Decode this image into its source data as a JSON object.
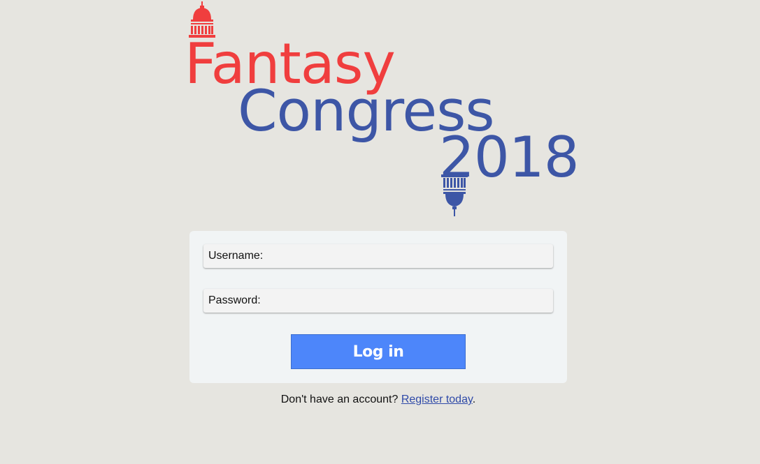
{
  "logo": {
    "line1": "Fantasy",
    "line2": "Congress",
    "line3": "2018",
    "color_red": "#f03e3e",
    "color_blue": "#3d56a6"
  },
  "login_form": {
    "username_label": "Username:",
    "username_value": "",
    "password_label": "Password:",
    "password_value": "",
    "submit_label": "Log in"
  },
  "footer": {
    "prompt": "Don't have an account? ",
    "register_link": "Register today",
    "suffix": "."
  },
  "colors": {
    "background": "#e6e5e0",
    "card": "#f1f4f5",
    "button": "#4d86fa",
    "link": "#2f4aa8"
  }
}
